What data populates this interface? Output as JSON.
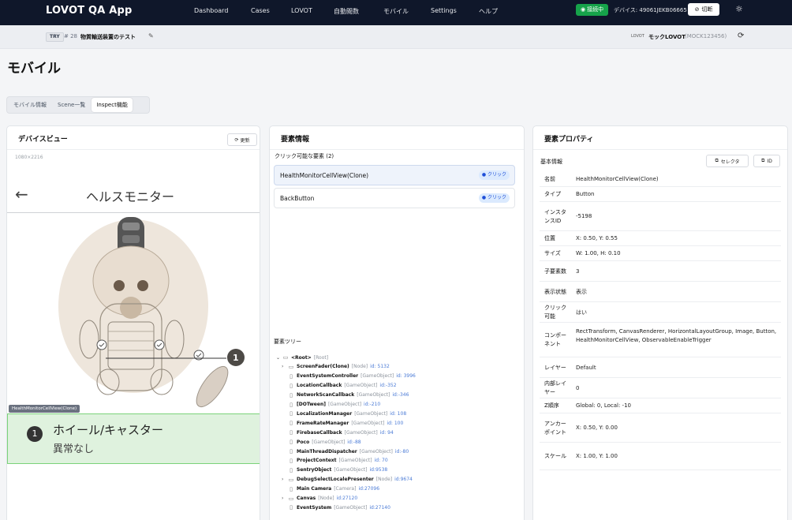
{
  "app": {
    "brand": "LOVOT QA App",
    "nav": [
      "Dashboard",
      "Cases",
      "LOVOT",
      "自動閲数",
      "モバイル",
      "Settings",
      "ヘルプ"
    ],
    "connection_badge": "接続中",
    "device_label": "デバイス: 49061JEKB06665",
    "disconnect_label": "切断"
  },
  "subheader": {
    "try_badge": "TRY",
    "case_number": "# 28",
    "case_title": "物質輸送装置のテスト",
    "lovot_label": "LOVOT",
    "mock_name": "モックLOVOT",
    "mock_id": "(MOCK123456)"
  },
  "page": {
    "title": "モバイル",
    "tabs": [
      "モバイル情報",
      "Scene一覧",
      "Inspect機能"
    ]
  },
  "device_view": {
    "title": "デバイスビュー",
    "refresh_label": "更新",
    "size": "1080×2216",
    "screen": {
      "back_glyph": "←",
      "title": "ヘルスモニター",
      "badge_number": "1",
      "highlight_label": "HealthMonitorCellView(Clone)",
      "cell_number": "1",
      "cell_name": "ホイール/キャスター",
      "cell_status": "異常なし"
    }
  },
  "element_info": {
    "title": "要素情報",
    "clickable_heading": "クリック可能な要素 (2)",
    "clickable": [
      {
        "name": "HealthMonitorCellView(Clone)",
        "badge": "クリック"
      },
      {
        "name": "BackButton",
        "badge": "クリック"
      }
    ],
    "tree_heading": "要素ツリー",
    "tree": [
      {
        "name": "<Root>",
        "type": "[Root]",
        "id": ""
      },
      {
        "name": "ScreenFader(Clone)",
        "type": "[Node]",
        "id": "id: 5132"
      },
      {
        "name": "EventSystemController",
        "type": "[GameObject]",
        "id": "id: 3996"
      },
      {
        "name": "LocationCallback",
        "type": "[GameObject]",
        "id": "id:-352"
      },
      {
        "name": "NetworkScanCallback",
        "type": "[GameObject]",
        "id": "id:-346"
      },
      {
        "name": "[DOTween]",
        "type": "[GameObject]",
        "id": "id:-210"
      },
      {
        "name": "LocalizationManager",
        "type": "[GameObject]",
        "id": "id: 108"
      },
      {
        "name": "FrameRateManager",
        "type": "[GameObject]",
        "id": "id: 100"
      },
      {
        "name": "FirebaseCallback",
        "type": "[GameObject]",
        "id": "id: 94"
      },
      {
        "name": "Poco",
        "type": "[GameObject]",
        "id": "id:-88"
      },
      {
        "name": "MainThreadDispatcher",
        "type": "[GameObject]",
        "id": "id:-80"
      },
      {
        "name": "ProjectContext",
        "type": "[GameObject]",
        "id": "id: 70"
      },
      {
        "name": "SentryObject",
        "type": "[GameObject]",
        "id": "id:9538"
      },
      {
        "name": "DebugSelectLocalePresenter",
        "type": "[Node]",
        "id": "id:9674"
      },
      {
        "name": "Main Camera",
        "type": "[Camera]",
        "id": "id:27096"
      },
      {
        "name": "Canvas",
        "type": "[Node]",
        "id": "id:27120"
      },
      {
        "name": "EventSystem",
        "type": "[GameObject]",
        "id": "id:27140"
      }
    ]
  },
  "properties": {
    "title": "要素プロパティ",
    "basic_heading": "基本情報",
    "selector_label": "セレクタ",
    "id_label": "ID",
    "rows": [
      {
        "key": "名前",
        "value": "HealthMonitorCellView(Clone)"
      },
      {
        "key": "タイプ",
        "value": "Button"
      },
      {
        "key": "インスタンスID",
        "value": "-5198"
      },
      {
        "key": "位置",
        "value": "X: 0.50, Y: 0.55"
      },
      {
        "key": "サイズ",
        "value": "W: 1.00, H: 0.10"
      },
      {
        "key": "子要素数",
        "value": "3"
      },
      {
        "key": "表示状態",
        "value": "表示"
      },
      {
        "key": "クリック可能",
        "value": "はい"
      },
      {
        "key": "コンポーネント",
        "value": "RectTransform, CanvasRenderer, HorizontalLayoutGroup, Image, Button, HealthMonitorCellView, ObservableEnableTrigger"
      },
      {
        "key": "レイヤー",
        "value": "Default"
      },
      {
        "key": "内部レイヤー",
        "value": "0"
      },
      {
        "key": "Z順序",
        "value": "Global: 0, Local: -10"
      },
      {
        "key": "アンカーポイント",
        "value": "X: 0.50, Y: 0.00"
      },
      {
        "key": "スケール",
        "value": "X: 1.00, Y: 1.00"
      }
    ]
  }
}
